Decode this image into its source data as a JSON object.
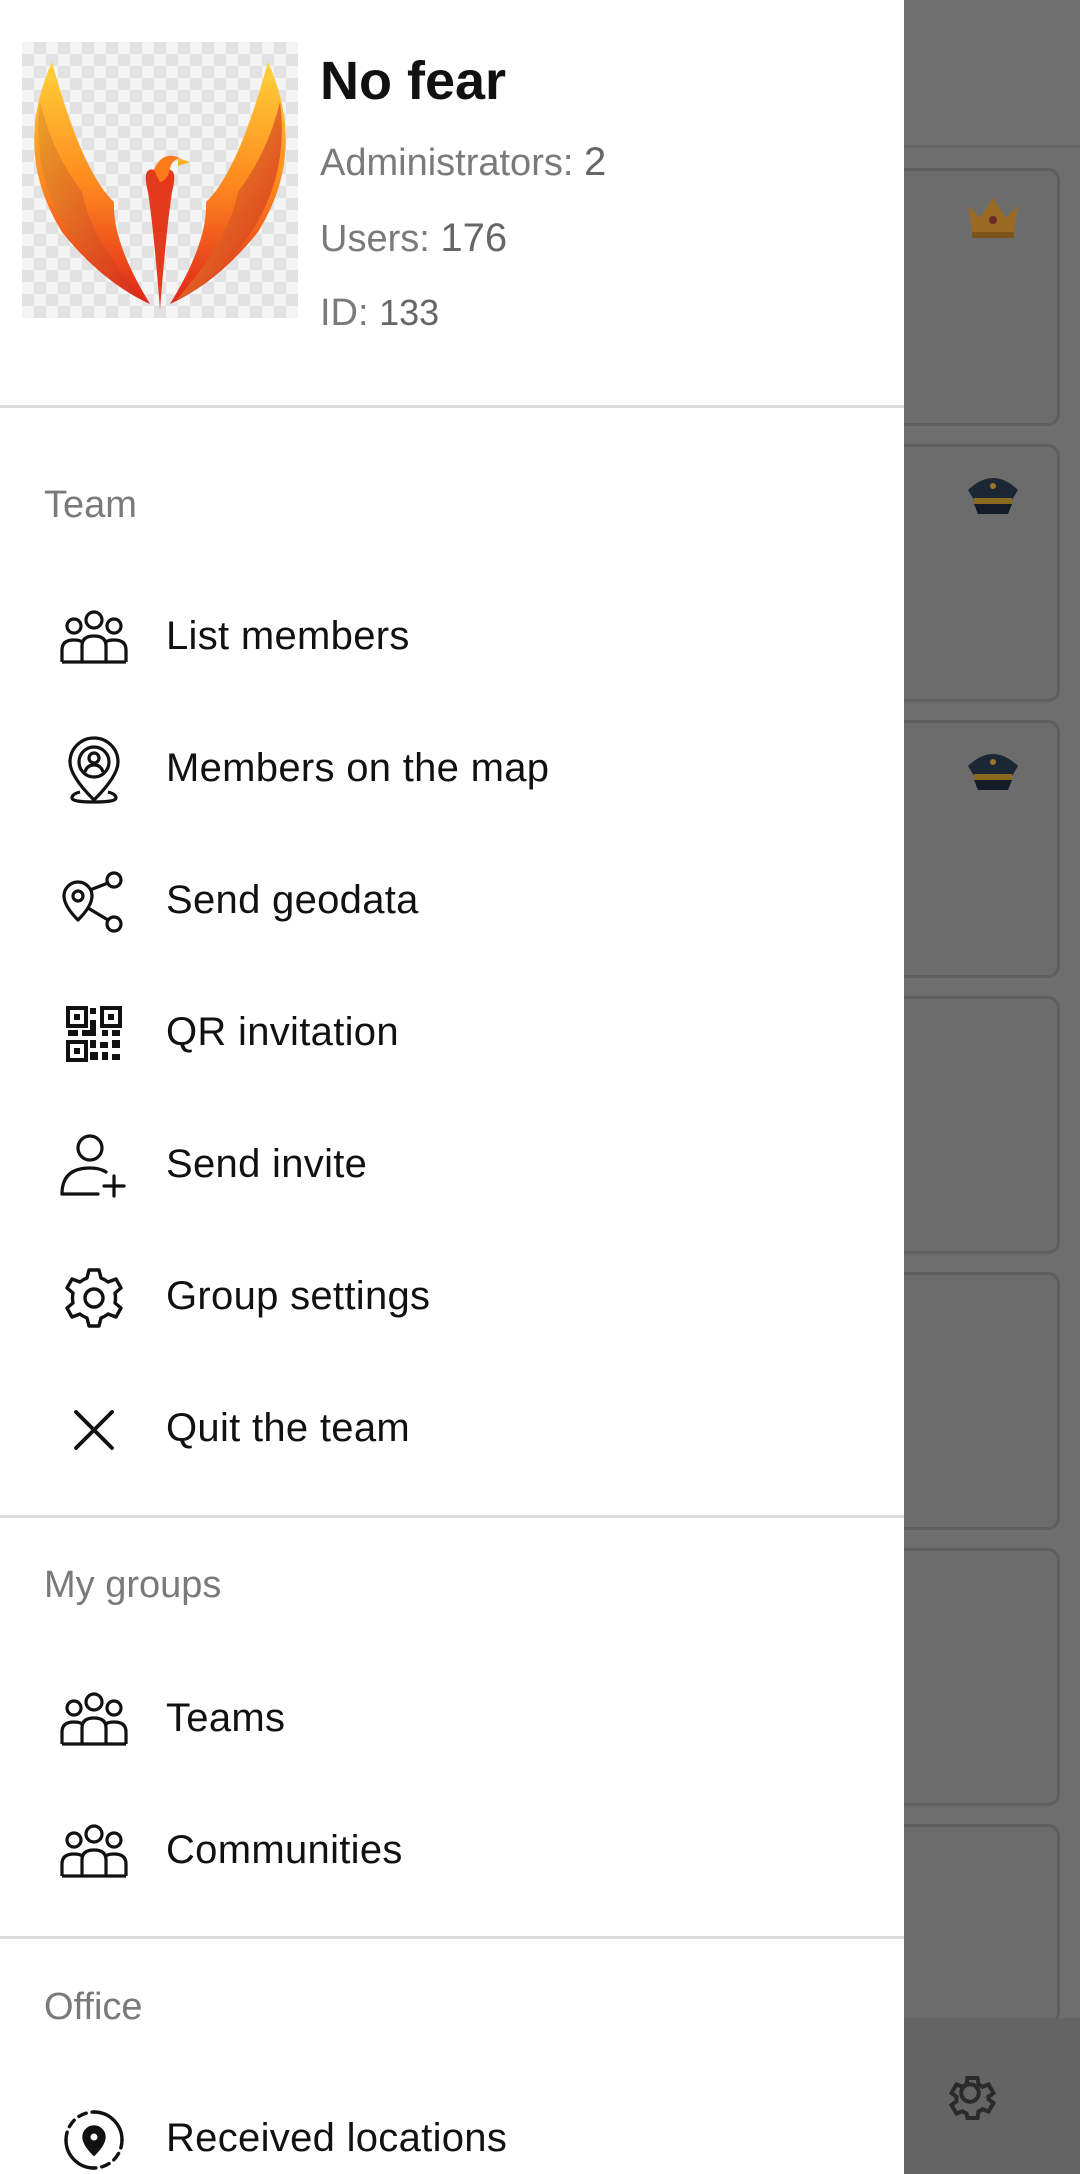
{
  "group": {
    "name": "No fear",
    "administrators_label": "Administrators:",
    "administrators_count": "2",
    "users_label": "Users:",
    "users_count": "176",
    "id_label": "ID:",
    "id_value": "133"
  },
  "sections": {
    "team": {
      "title": "Team",
      "items": [
        {
          "label": "List members",
          "icon": "people-group-icon"
        },
        {
          "label": "Members on the map",
          "icon": "map-pin-user-icon"
        },
        {
          "label": "Send geodata",
          "icon": "share-location-icon"
        },
        {
          "label": "QR invitation",
          "icon": "qr-code-icon"
        },
        {
          "label": "Send invite",
          "icon": "add-user-icon"
        },
        {
          "label": "Group settings",
          "icon": "gear-icon"
        },
        {
          "label": "Quit the team",
          "icon": "close-icon"
        }
      ]
    },
    "my_groups": {
      "title": "My groups",
      "items": [
        {
          "label": "Teams",
          "icon": "people-group-icon"
        },
        {
          "label": "Communities",
          "icon": "people-group-icon"
        }
      ]
    },
    "office": {
      "title": "Office",
      "items": [
        {
          "label": "Received locations",
          "icon": "location-target-icon"
        }
      ]
    }
  },
  "colors": {
    "drawer_background": "#ffffff",
    "scrim": "#6e6e6e",
    "text_primary": "#111111",
    "text_secondary": "#7a7a7a",
    "divider": "#dcdcdc",
    "crown_badge": "#b07a2a",
    "police_badge": "#1e2a3a"
  }
}
